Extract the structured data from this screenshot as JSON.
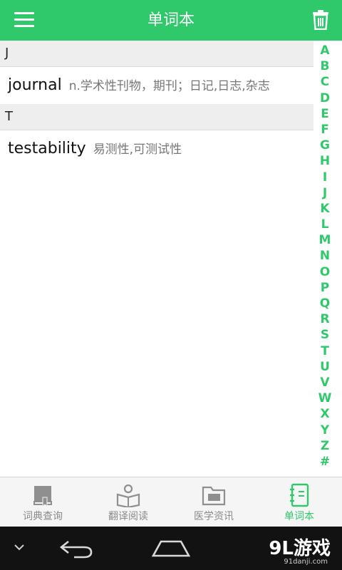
{
  "header": {
    "title": "单词本",
    "menu_icon": "menu-icon",
    "trash_icon": "trash-icon"
  },
  "sections": [
    {
      "letter": "J",
      "entries": [
        {
          "word": "journal",
          "meaning": "n.学术性刊物，期刊；日记,日志,杂志"
        }
      ]
    },
    {
      "letter": "T",
      "entries": [
        {
          "word": "testability",
          "meaning": "易测性,可测试性"
        }
      ]
    }
  ],
  "alphabet": [
    "A",
    "B",
    "C",
    "D",
    "E",
    "F",
    "G",
    "H",
    "I",
    "J",
    "K",
    "L",
    "M",
    "N",
    "O",
    "P",
    "Q",
    "R",
    "S",
    "T",
    "U",
    "V",
    "W",
    "X",
    "Y",
    "Z",
    "#"
  ],
  "tabs": [
    {
      "label": "词典查询",
      "icon": "dictionary-icon",
      "active": false
    },
    {
      "label": "翻译阅读",
      "icon": "reading-icon",
      "active": false
    },
    {
      "label": "医学资讯",
      "icon": "news-folder-icon",
      "active": false
    },
    {
      "label": "单词本",
      "icon": "notebook-icon",
      "active": true
    }
  ],
  "colors": {
    "accent": "#2fc86b",
    "tab_inactive": "#8a8a8a",
    "nav_bg": "#121212"
  },
  "watermark": {
    "brand": "9L游戏",
    "site": "91danji.com"
  }
}
